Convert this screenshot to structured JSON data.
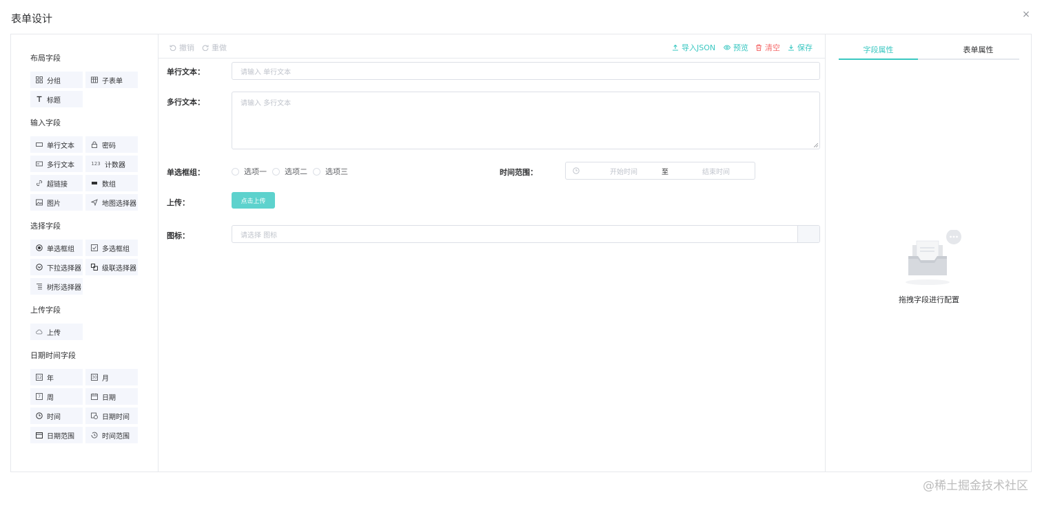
{
  "dialog": {
    "title": "表单设计",
    "close_glyph": "×"
  },
  "left": {
    "groups": [
      {
        "title": "布局字段",
        "items": [
          {
            "label": "分组",
            "icon": "grid-icon"
          },
          {
            "label": "子表单",
            "icon": "table-icon"
          },
          {
            "label": "标题",
            "icon": "text-t-icon"
          }
        ]
      },
      {
        "title": "输入字段",
        "items": [
          {
            "label": "单行文本",
            "icon": "input-icon"
          },
          {
            "label": "密码",
            "icon": "lock-icon"
          },
          {
            "label": "多行文本",
            "icon": "textarea-icon"
          },
          {
            "label": "计数器",
            "icon": "number-icon",
            "glyph": "123"
          },
          {
            "label": "超链接",
            "icon": "link-icon"
          },
          {
            "label": "数组",
            "icon": "array-icon"
          },
          {
            "label": "图片",
            "icon": "image-icon"
          },
          {
            "label": "地图选择器",
            "icon": "location-icon"
          }
        ]
      },
      {
        "title": "选择字段",
        "items": [
          {
            "label": "单选框组",
            "icon": "radio-icon"
          },
          {
            "label": "多选框组",
            "icon": "checkbox-icon"
          },
          {
            "label": "下拉选择器",
            "icon": "select-icon"
          },
          {
            "label": "级联选择器",
            "icon": "cascader-icon"
          },
          {
            "label": "树形选择器",
            "icon": "tree-icon"
          }
        ]
      },
      {
        "title": "上传字段",
        "items": [
          {
            "label": "上传",
            "icon": "upload-cloud-icon"
          }
        ]
      },
      {
        "title": "日期时间字段",
        "items": [
          {
            "label": "年",
            "icon": "calendar-year-icon",
            "glyph": "12"
          },
          {
            "label": "月",
            "icon": "calendar-month-icon",
            "glyph": "30"
          },
          {
            "label": "周",
            "icon": "calendar-week-icon",
            "glyph": "7"
          },
          {
            "label": "日期",
            "icon": "calendar-date-icon"
          },
          {
            "label": "时间",
            "icon": "clock-icon"
          },
          {
            "label": "日期时间",
            "icon": "datetime-icon"
          },
          {
            "label": "日期范围",
            "icon": "date-range-icon"
          },
          {
            "label": "时间范围",
            "icon": "time-range-icon"
          }
        ]
      }
    ]
  },
  "toolbar": {
    "undo": "撤销",
    "redo": "重做",
    "import_json": "导入JSON",
    "preview": "预览",
    "clear": "清空",
    "save": "保存"
  },
  "form": {
    "single_line": {
      "label": "单行文本：",
      "placeholder": "请输入 单行文本"
    },
    "multi_line": {
      "label": "多行文本：",
      "placeholder": "请输入 多行文本"
    },
    "radio_group": {
      "label": "单选框组：",
      "options": [
        "选项一",
        "选项二",
        "选项三"
      ]
    },
    "time_range": {
      "label": "时间范围：",
      "start_placeholder": "开始时间",
      "separator": "至",
      "end_placeholder": "结束时间"
    },
    "upload": {
      "label": "上传：",
      "button": "点击上传"
    },
    "icon": {
      "label": "图标：",
      "placeholder": "请选择 图标"
    }
  },
  "right": {
    "tabs": [
      {
        "label": "字段属性",
        "active": true
      },
      {
        "label": "表单属性",
        "active": false
      }
    ],
    "empty_text": "拖拽字段进行配置"
  },
  "colors": {
    "accent": "#39c7c1",
    "danger": "#f56c6c",
    "upload_button": "#5dd2cd"
  },
  "watermark": "@稀土掘金技术社区"
}
